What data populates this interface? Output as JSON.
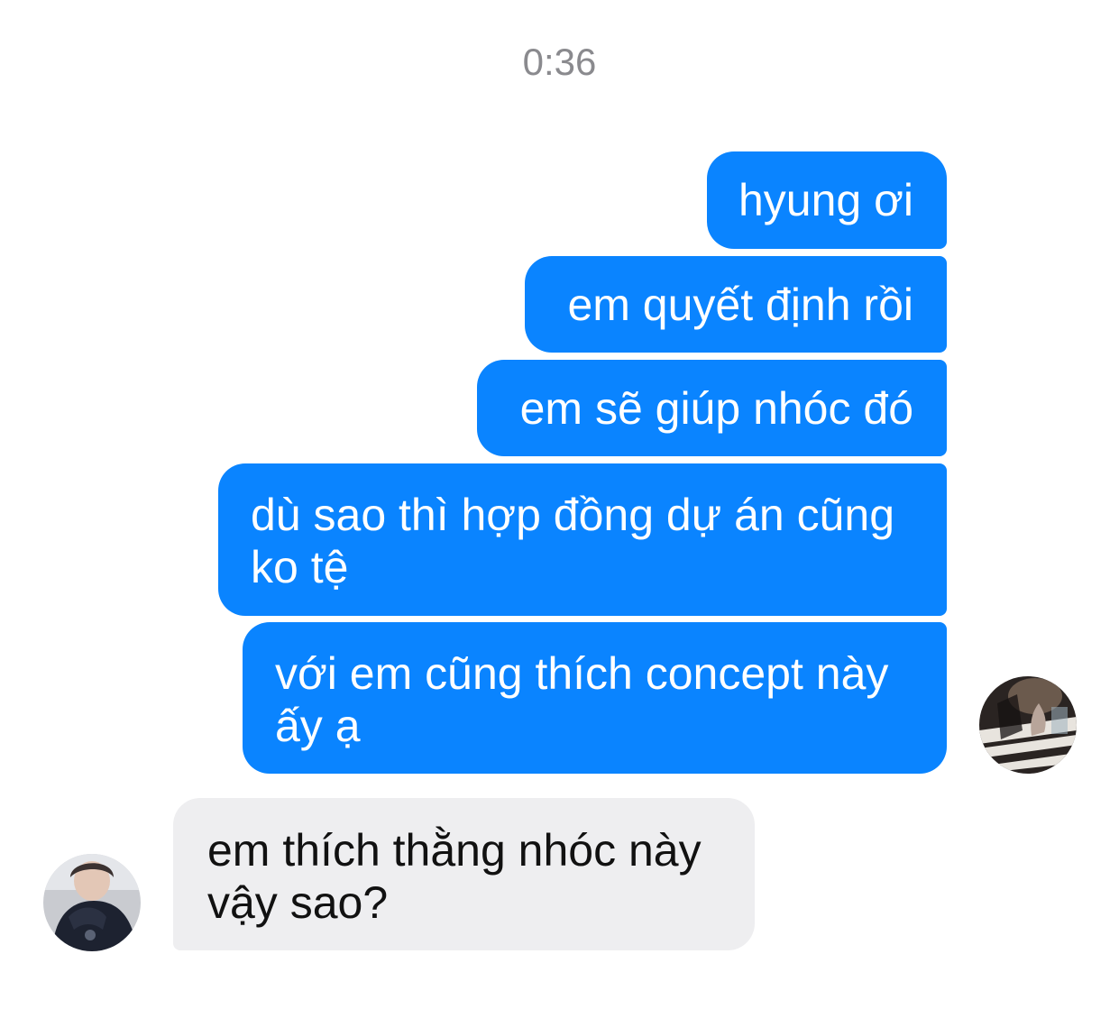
{
  "timestamp": "0:36",
  "messages": [
    {
      "direction": "outgoing",
      "text": "hyung ơi"
    },
    {
      "direction": "outgoing",
      "text": "em quyết định rồi"
    },
    {
      "direction": "outgoing",
      "text": "em sẽ giúp nhóc đó"
    },
    {
      "direction": "outgoing",
      "lines": [
        "dù sao thì hợp đồng dự án cũng",
        "ko tệ"
      ]
    },
    {
      "direction": "outgoing",
      "lines": [
        "với em cũng thích concept này",
        "ấy ạ"
      ]
    },
    {
      "direction": "incoming",
      "lines": [
        "em thích thằng nhóc này",
        "vậy sao?"
      ]
    }
  ],
  "colors": {
    "outgoing_bubble": "#0a84ff",
    "outgoing_text": "#ffffff",
    "incoming_bubble": "#eeeef0",
    "incoming_text": "#111111",
    "timestamp_text": "#8a8a8e"
  }
}
